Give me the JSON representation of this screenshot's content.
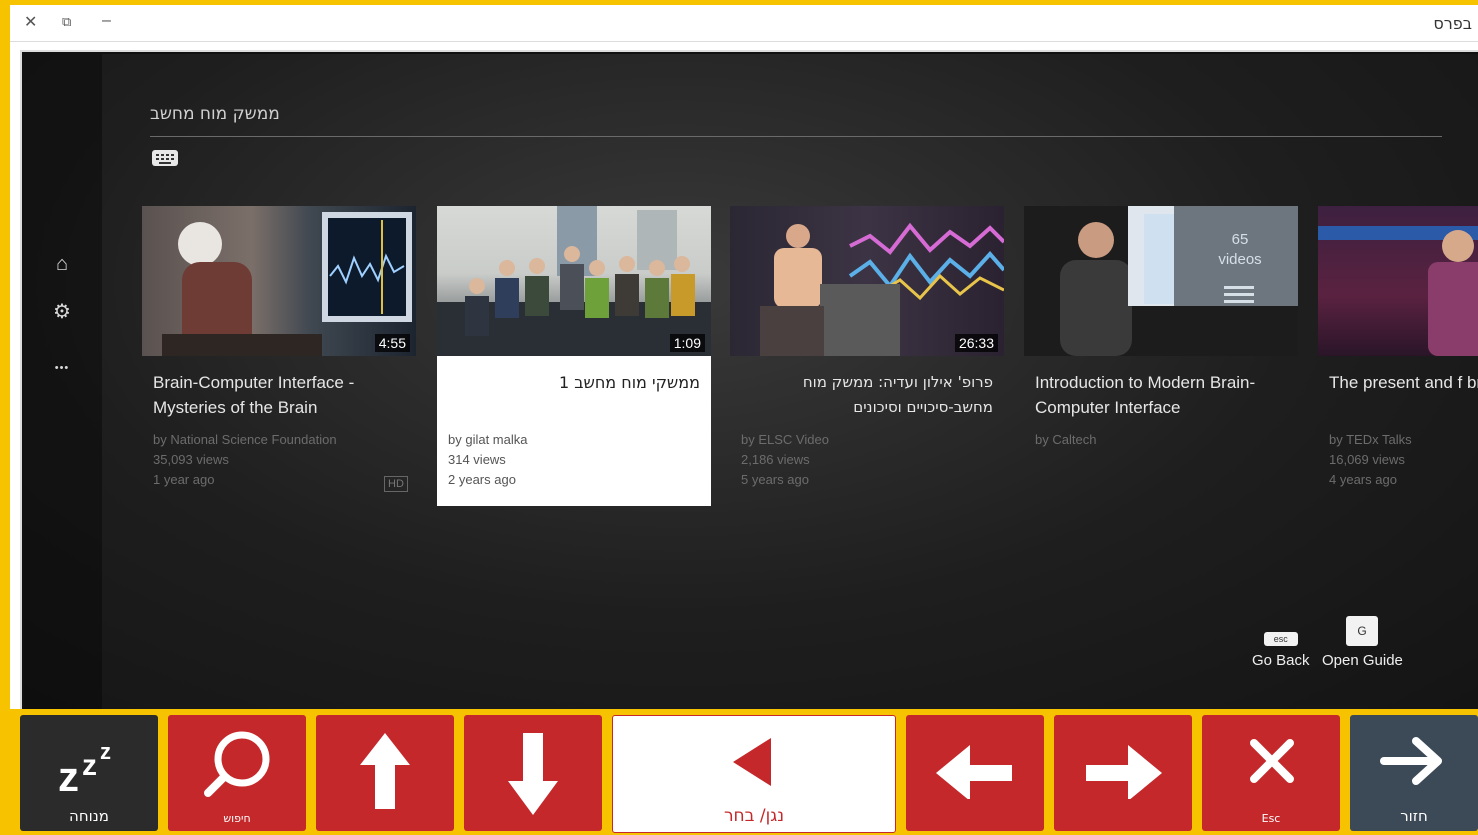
{
  "window": {
    "title": "בפרס",
    "close_glyph": "✕",
    "restore_glyph": "⧉",
    "minimize_glyph": "–"
  },
  "search": {
    "query": "ממשק מוח מחשב"
  },
  "rail": {
    "home_glyph": "⌂",
    "settings_glyph": "⚙",
    "more_glyph": "•••"
  },
  "videos": [
    {
      "title": "Brain-Computer Interface - Mysteries of the Brain",
      "channel": "by National Science Foundation",
      "views": "35,093 views",
      "age": "1 year ago",
      "duration": "4:55",
      "badge": "HD"
    },
    {
      "title": "ממשקי מוח מחשב 1",
      "channel": "by gilat malka",
      "views": "314 views",
      "age": "2 years ago",
      "duration": "1:09"
    },
    {
      "title": "פרופ' אילון ועדיה: ממשק מוח מחשב-סיכויים וסיכונים",
      "channel": "by ELSC Video",
      "views": "2,186 views",
      "age": "5 years ago",
      "duration": "26:33"
    },
    {
      "title": "Introduction to Modern Brain-Computer Interface",
      "channel": "by Caltech",
      "playlist": "65 videos"
    },
    {
      "title": "The present and f brain-computer in",
      "channel": "by TEDx Talks",
      "views": "16,069 views",
      "age": "4 years ago"
    }
  ],
  "guide": {
    "back_key": "esc",
    "back_label": "Go Back",
    "open_key": "G",
    "open_label": "Open Guide"
  },
  "controls": {
    "rest_label": "מנוחה",
    "search_label": "חיפוש",
    "play_select_label": "נגן/ בחר",
    "esc_label": "Esc",
    "back_label": "חזור"
  },
  "colors": {
    "accent_red": "#c5282a",
    "frame_yellow": "#f7c300"
  }
}
